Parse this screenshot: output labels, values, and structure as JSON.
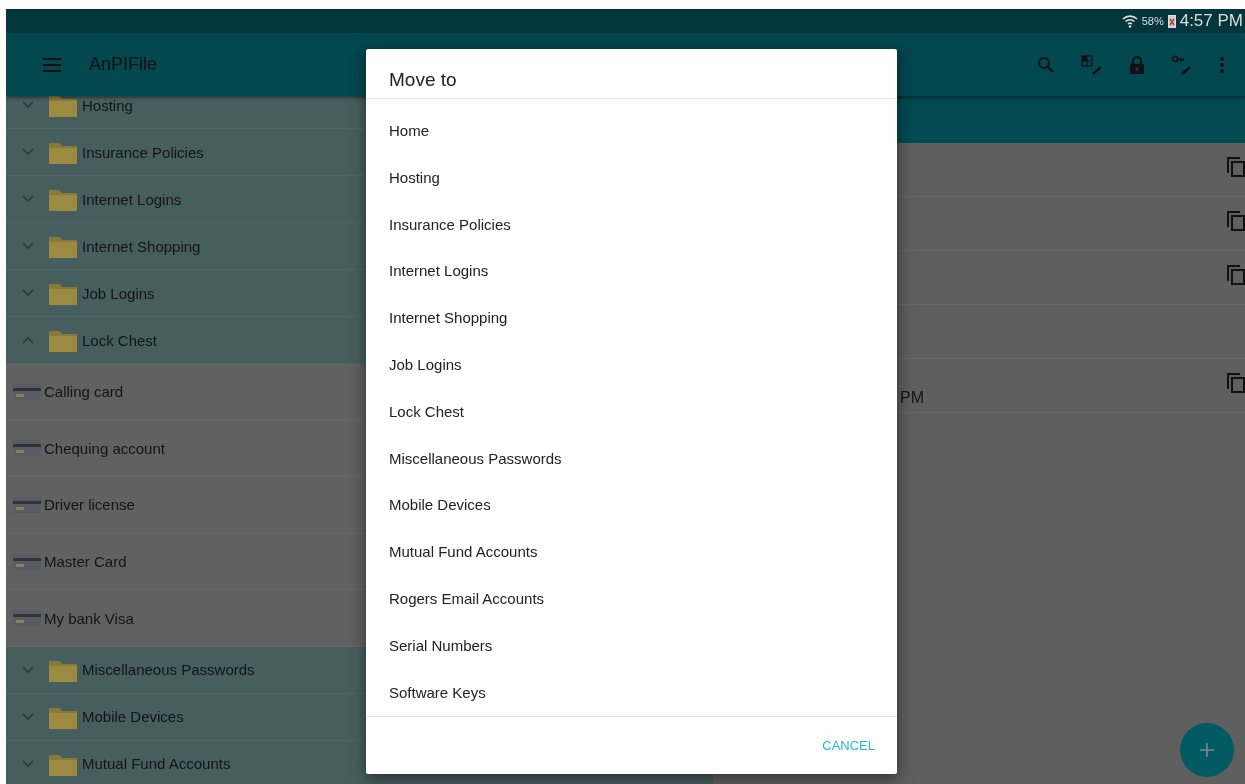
{
  "status_bar": {
    "battery": "58%",
    "time": "4:57 PM"
  },
  "app_bar": {
    "title": "AnPIFile"
  },
  "folders": [
    {
      "label": "Hosting",
      "expanded": false
    },
    {
      "label": "Insurance Policies",
      "expanded": false
    },
    {
      "label": "Internet Logins",
      "expanded": false
    },
    {
      "label": "Internet Shopping",
      "expanded": false
    },
    {
      "label": "Job Logins",
      "expanded": false
    },
    {
      "label": "Lock Chest",
      "expanded": true,
      "children": [
        {
          "label": "Calling card"
        },
        {
          "label": "Chequing account"
        },
        {
          "label": "Driver license"
        },
        {
          "label": "Master Card"
        },
        {
          "label": "My bank Visa"
        }
      ]
    },
    {
      "label": "Miscellaneous Passwords",
      "expanded": false
    },
    {
      "label": "Mobile Devices",
      "expanded": false
    },
    {
      "label": "Mutual Fund Accounts",
      "expanded": false
    }
  ],
  "detail_rows": [
    {
      "copyable": true
    },
    {
      "copyable": true
    },
    {
      "copyable": true
    },
    {
      "copyable": false
    },
    {
      "value": "PM",
      "copyable": true
    }
  ],
  "dialog": {
    "title": "Move to",
    "items": [
      "Home",
      "Hosting",
      "Insurance Policies",
      "Internet Logins",
      "Internet Shopping",
      "Job Logins",
      "Lock Chest",
      "Miscellaneous Passwords",
      "Mobile Devices",
      "Mutual Fund Accounts",
      "Rogers Email Accounts",
      "Serial Numbers",
      "Software Keys"
    ],
    "cancel": "CANCEL"
  }
}
